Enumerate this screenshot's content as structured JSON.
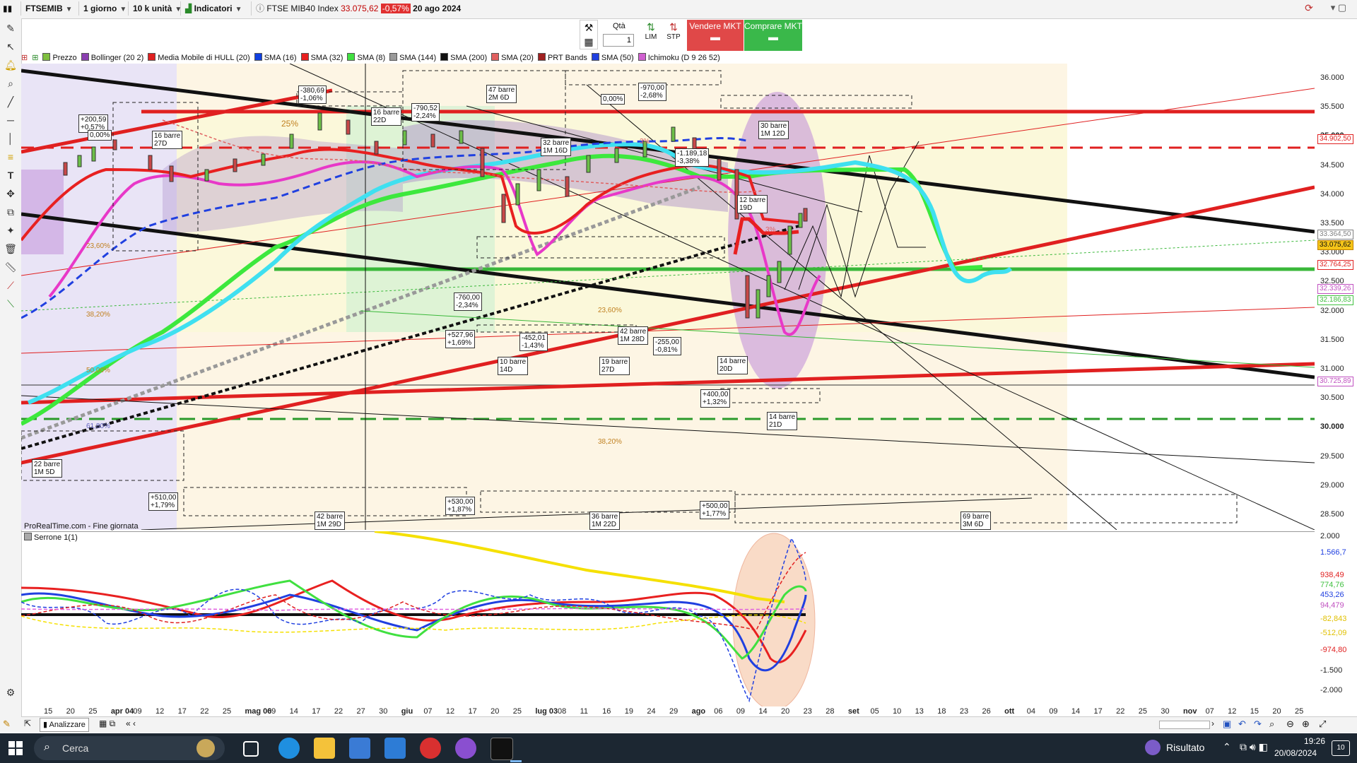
{
  "toolbar": {
    "symbol": "FTSEMIB",
    "timeframe": "1 giorno",
    "units": "10 k unità",
    "indicators_label": "Indicatori",
    "instrument_name": "FTSE MIB40 Index",
    "last_price": "33.075,62",
    "change_pct": "-0,57%",
    "date": "20 ago 2024"
  },
  "order_panel": {
    "qty_label": "Qtà",
    "qty_value": "1",
    "lim_label": "LIM",
    "stp_label": "STP",
    "sell_label": "Vendere MKT",
    "buy_label": "Comprare MKT"
  },
  "legend": [
    {
      "label": "Prezzo",
      "color": "#7fbf3f"
    },
    {
      "label": "Bollinger (20 2)",
      "color": "#8a3fb0"
    },
    {
      "label": "Media Mobile di HULL (20)",
      "color": "#e02020"
    },
    {
      "label": "SMA (16)",
      "color": "#1040e0"
    },
    {
      "label": "SMA (32)",
      "color": "#e82020"
    },
    {
      "label": "SMA (8)",
      "color": "#40e040"
    },
    {
      "label": "SMA (144)",
      "color": "#9a9a9a"
    },
    {
      "label": "SMA (200)",
      "color": "#111111"
    },
    {
      "label": "SMA (20)",
      "color": "#e06060"
    },
    {
      "label": "PRT Bands",
      "color": "#a02020"
    },
    {
      "label": "SMA (50)",
      "color": "#2040e0"
    },
    {
      "label": "Ichimoku (D 9 26 52)",
      "color": "#d060d0"
    }
  ],
  "price_axis": [
    "36.000",
    "35.500",
    "35.000",
    "34.500",
    "34.000",
    "33.500",
    "33.000",
    "32.500",
    "32.000",
    "31.500",
    "31.000",
    "30.500",
    "30.000",
    "29.500",
    "29.000",
    "28.500"
  ],
  "price_tags": [
    {
      "label": "34.902,50",
      "color": "#e02020"
    },
    {
      "label": "33.364,50",
      "color": "#808080"
    },
    {
      "label": "33.075,62",
      "color": "#c08000",
      "bg": "#f5c518"
    },
    {
      "label": "32.764,25",
      "color": "#e02020"
    },
    {
      "label": "32.339,26",
      "color": "#c050c0"
    },
    {
      "label": "32.186,83",
      "color": "#40c040"
    },
    {
      "label": "30.725,89",
      "color": "#c050c0"
    }
  ],
  "osc": {
    "title": "Serrone 1(1)",
    "axis": [
      "2.000",
      "1.566,7",
      "938,49",
      "774,76",
      "453,26",
      "94,479",
      "-82,843",
      "-512,09",
      "-974,80",
      "-1.500",
      "-2.000"
    ],
    "axis_colors": [
      "#222222",
      "#2040e0",
      "#e02020",
      "#40c040",
      "#2040e0",
      "#c050c0",
      "#e0c000",
      "#e0c000",
      "#e02020",
      "#222222",
      "#222222"
    ]
  },
  "x_axis": [
    {
      "label": "15",
      "bold": false
    },
    {
      "label": "20",
      "bold": false
    },
    {
      "label": "25",
      "bold": false
    },
    {
      "label": "apr 04",
      "bold": true
    },
    {
      "label": "09",
      "bold": false
    },
    {
      "label": "12",
      "bold": false
    },
    {
      "label": "17",
      "bold": false
    },
    {
      "label": "22",
      "bold": false
    },
    {
      "label": "25",
      "bold": false
    },
    {
      "label": "mag 06",
      "bold": true
    },
    {
      "label": "09",
      "bold": false
    },
    {
      "label": "14",
      "bold": false
    },
    {
      "label": "17",
      "bold": false
    },
    {
      "label": "22",
      "bold": false
    },
    {
      "label": "27",
      "bold": false
    },
    {
      "label": "30",
      "bold": false
    },
    {
      "label": "giu",
      "bold": true
    },
    {
      "label": "07",
      "bold": false
    },
    {
      "label": "12",
      "bold": false
    },
    {
      "label": "17",
      "bold": false
    },
    {
      "label": "20",
      "bold": false
    },
    {
      "label": "25",
      "bold": false
    },
    {
      "label": "lug 03",
      "bold": true
    },
    {
      "label": "08",
      "bold": false
    },
    {
      "label": "11",
      "bold": false
    },
    {
      "label": "16",
      "bold": false
    },
    {
      "label": "19",
      "bold": false
    },
    {
      "label": "24",
      "bold": false
    },
    {
      "label": "29",
      "bold": false
    },
    {
      "label": "ago",
      "bold": true
    },
    {
      "label": "06",
      "bold": false
    },
    {
      "label": "09",
      "bold": false
    },
    {
      "label": "14",
      "bold": false
    },
    {
      "label": "20",
      "bold": false
    },
    {
      "label": "23",
      "bold": false
    },
    {
      "label": "28",
      "bold": false
    },
    {
      "label": "set",
      "bold": true
    },
    {
      "label": "05",
      "bold": false
    },
    {
      "label": "10",
      "bold": false
    },
    {
      "label": "13",
      "bold": false
    },
    {
      "label": "18",
      "bold": false
    },
    {
      "label": "23",
      "bold": false
    },
    {
      "label": "26",
      "bold": false
    },
    {
      "label": "ott",
      "bold": true
    },
    {
      "label": "04",
      "bold": false
    },
    {
      "label": "09",
      "bold": false
    },
    {
      "label": "14",
      "bold": false
    },
    {
      "label": "17",
      "bold": false
    },
    {
      "label": "22",
      "bold": false
    },
    {
      "label": "25",
      "bold": false
    },
    {
      "label": "30",
      "bold": false
    },
    {
      "label": "nov",
      "bold": true
    },
    {
      "label": "07",
      "bold": false
    },
    {
      "label": "12",
      "bold": false
    },
    {
      "label": "15",
      "bold": false
    },
    {
      "label": "20",
      "bold": false
    },
    {
      "label": "25",
      "bold": false
    }
  ],
  "annotations": [
    {
      "text": "+200,59\n+0,57%"
    },
    {
      "text": "0,00%"
    },
    {
      "text": "16 barre\n27D"
    },
    {
      "text": "-380,69\n-1,06%"
    },
    {
      "text": "16 barre\n22D"
    },
    {
      "text": "-790,52\n-2,24%"
    },
    {
      "text": "47 barre\n2M 6D"
    },
    {
      "text": "0,00%"
    },
    {
      "text": "-970,00\n-2,68%"
    },
    {
      "text": "30 barre\n1M 12D"
    },
    {
      "text": "32 barre\n1M 16D"
    },
    {
      "text": "-1.189,18\n-3,38%"
    },
    {
      "text": "12 barre\n19D"
    },
    {
      "text": "-760,00\n-2,34%"
    },
    {
      "text": "+527,96\n+1,69%"
    },
    {
      "text": "-452,01\n-1,43%"
    },
    {
      "text": "10 barre\n14D"
    },
    {
      "text": "42 barre\n1M 28D"
    },
    {
      "text": "-255,00\n-0,81%"
    },
    {
      "text": "19 barre\n27D"
    },
    {
      "text": "14 barre\n20D"
    },
    {
      "text": "+400,00\n+1,32%"
    },
    {
      "text": "14 barre\n21D"
    },
    {
      "text": "22 barre\n1M 5D"
    },
    {
      "text": "+510,00\n+1,79%"
    },
    {
      "text": "42 barre\n1M 29D"
    },
    {
      "text": "+530,00\n+1,87%"
    },
    {
      "text": "36 barre\n1M 22D"
    },
    {
      "text": "+500,00\n+1,77%"
    },
    {
      "text": "69 barre\n3M 6D"
    }
  ],
  "fib_labels": [
    "25%",
    "3%",
    "23,60%",
    "38,20%",
    "50,00%",
    "61,80%",
    "23,60%",
    "38,20%",
    "3%"
  ],
  "source_note": "ProRealTime.com - Fine giornata",
  "nav": {
    "analyze_label": "Analizzare"
  },
  "taskbar": {
    "search_placeholder": "Cerca",
    "result_label": "Risultato",
    "time": "19:26",
    "date": "20/08/2024",
    "notif_count": "10"
  }
}
